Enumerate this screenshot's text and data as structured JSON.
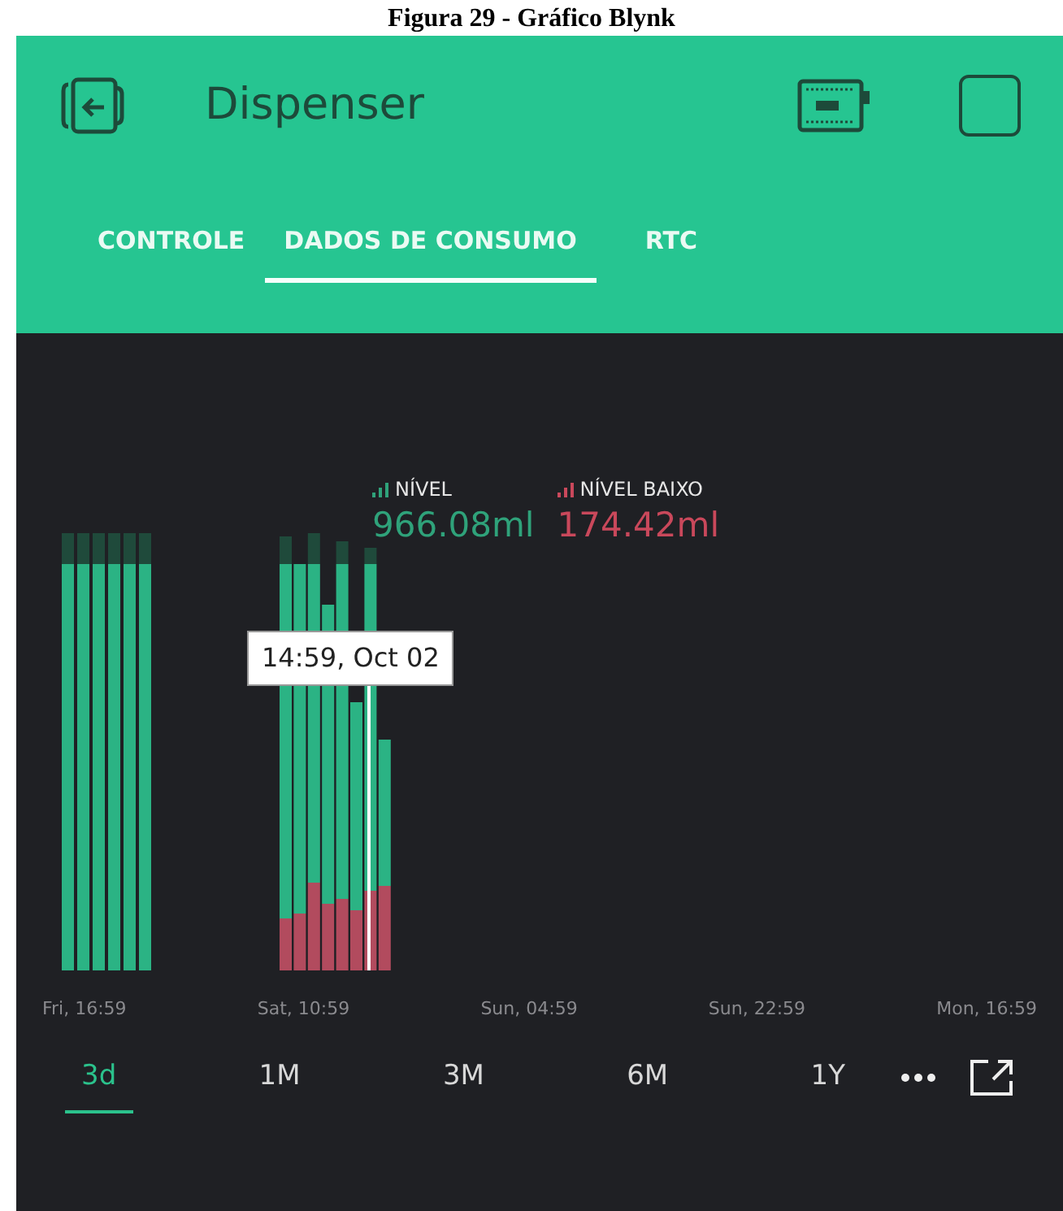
{
  "caption": "Figura 29 - Gráfico Blynk",
  "header": {
    "title": "Dispenser"
  },
  "tabs": [
    {
      "label": "CONTROLE",
      "selected": false
    },
    {
      "label": "DADOS DE CONSUMO",
      "selected": true
    },
    {
      "label": "RTC",
      "selected": false
    }
  ],
  "legend": [
    {
      "label": "NÍVEL",
      "value": "966.08ml",
      "color": "#2fa27a"
    },
    {
      "label": "NÍVEL BAIXO",
      "value": "174.42ml",
      "color": "#c9485b"
    }
  ],
  "tooltip": "14:59, Oct 02",
  "x_labels": [
    "Fri, 16:59",
    "Sat, 10:59",
    "Sun, 04:59",
    "Sun, 22:59",
    "Mon, 16:59"
  ],
  "ranges": [
    {
      "label": "3d",
      "selected": true
    },
    {
      "label": "1M",
      "selected": false
    },
    {
      "label": "3M",
      "selected": false
    },
    {
      "label": "6M",
      "selected": false
    },
    {
      "label": "1Y",
      "selected": false
    }
  ]
}
